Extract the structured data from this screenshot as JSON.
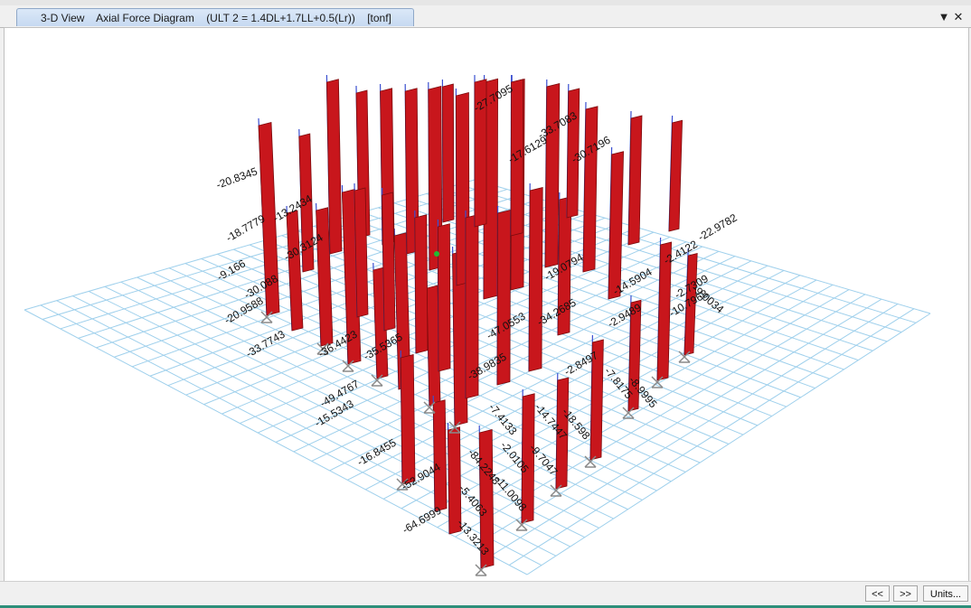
{
  "window": {
    "tab": {
      "view_name": "3-D View",
      "diagram_name": "Axial Force Diagram",
      "load_combo": "(ULT 2 = 1.4DL+1.7LL+0.5(Lr))",
      "units": "[tonf]"
    },
    "menu_icon": "triangle-down",
    "close_icon": "x"
  },
  "diagram": {
    "labels": [
      "-20.8345",
      "-13.2434",
      "-18.7779",
      "-30.3124",
      "-9.166",
      "-20.9588",
      "-30.088",
      "-33.7743",
      "-49.4767",
      "-15.5343",
      "-16.8455",
      "-52.9044",
      "-64.6999",
      "-5.4063",
      "-13.3213",
      "-84.2248",
      "-11.0098",
      "-2.0105",
      "-9.7047",
      "-7.4133",
      "-14.7447",
      "-18.598",
      "-2.8497",
      "-7.8175",
      "-8.9995",
      "-2.9489",
      "-14.5904",
      "-10.7968",
      "-2.4122",
      "-2.7309",
      "-22.9782",
      "-34.2685",
      "-30.7196",
      "-33.7083",
      "-17.6129",
      "-27.7095",
      "-35.5365",
      "-36.4423",
      "-47.0553",
      "-38.9835",
      "-19.0794",
      "-9.0034"
    ]
  },
  "statusbar": {
    "prev_label": "<<",
    "next_label": ">>",
    "units_label": "Units..."
  }
}
